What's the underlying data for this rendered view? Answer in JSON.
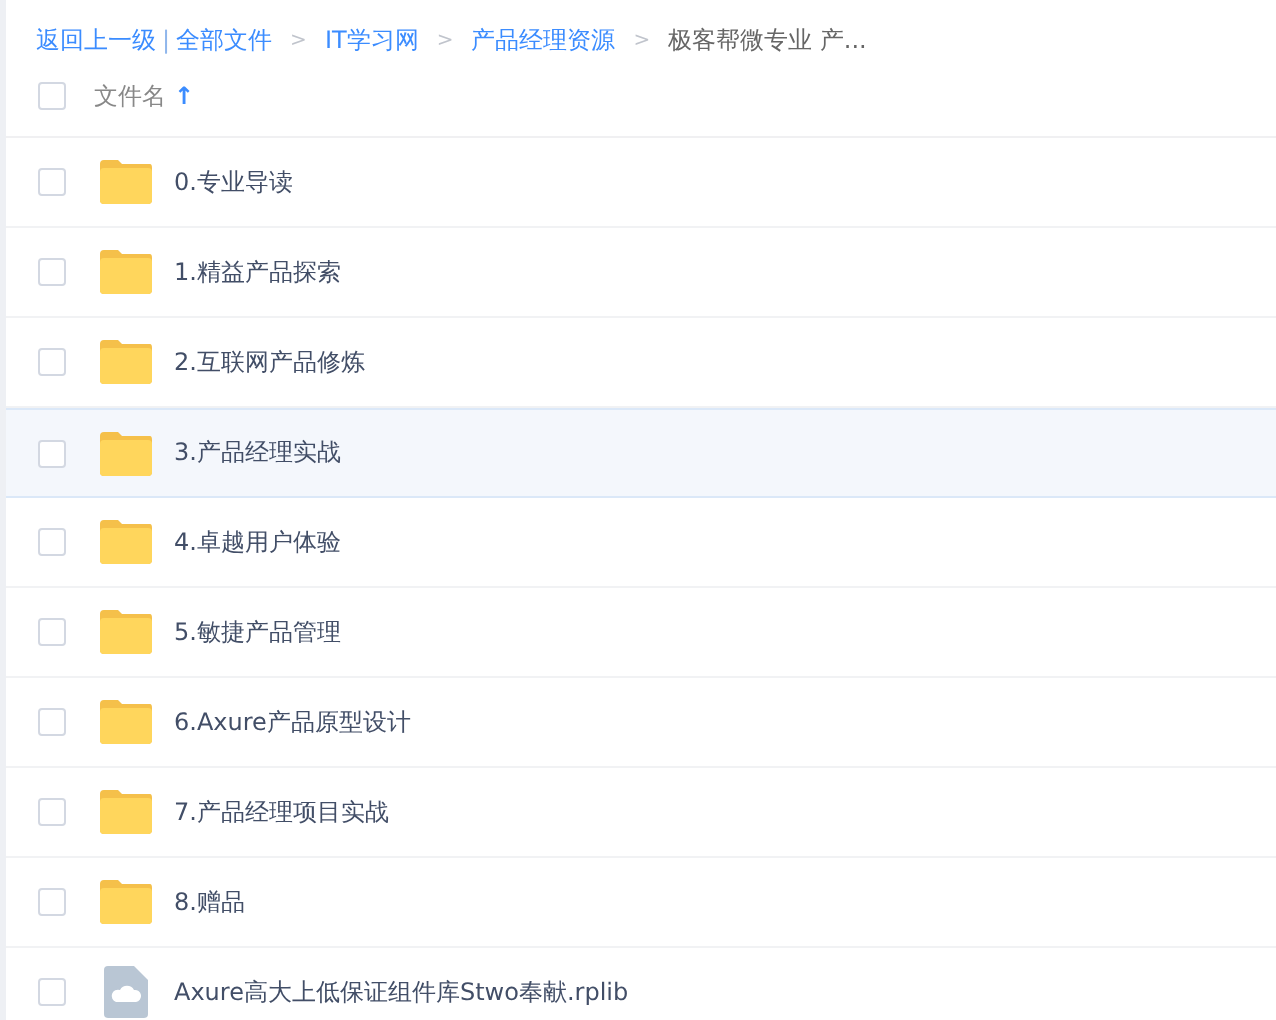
{
  "breadcrumb": {
    "back": "返回上一级",
    "divider": "|",
    "items": [
      {
        "label": "全部文件",
        "kind": "link"
      },
      {
        "separator": ">",
        "label": "IT学习网",
        "kind": "link"
      },
      {
        "separator": ">",
        "label": "产品经理资源",
        "kind": "link"
      },
      {
        "separator": ">",
        "label": "极客帮微专业 产...",
        "kind": "current"
      }
    ]
  },
  "header": {
    "checked": false,
    "column": "文件名",
    "sort_arrow": "↑"
  },
  "rows": [
    {
      "name": "0.专业导读",
      "kind": "folder",
      "checked": false,
      "highlighted": false
    },
    {
      "name": "1.精益产品探索",
      "kind": "folder",
      "checked": false,
      "highlighted": false
    },
    {
      "name": "2.互联网产品修炼",
      "kind": "folder",
      "checked": false,
      "highlighted": false
    },
    {
      "name": "3.产品经理实战",
      "kind": "folder",
      "checked": false,
      "highlighted": true
    },
    {
      "name": "4.卓越用户体验",
      "kind": "folder",
      "checked": false,
      "highlighted": false
    },
    {
      "name": "5.敏捷产品管理",
      "kind": "folder",
      "checked": false,
      "highlighted": false
    },
    {
      "name": "6.Axure产品原型设计",
      "kind": "folder",
      "checked": false,
      "highlighted": false
    },
    {
      "name": "7.产品经理项目实战",
      "kind": "folder",
      "checked": false,
      "highlighted": false
    },
    {
      "name": "8.赠品",
      "kind": "folder",
      "checked": false,
      "highlighted": false
    },
    {
      "name": "Axure高大上低保证组件库Stwo奉献.rplib",
      "kind": "file",
      "checked": false,
      "highlighted": false
    }
  ]
}
